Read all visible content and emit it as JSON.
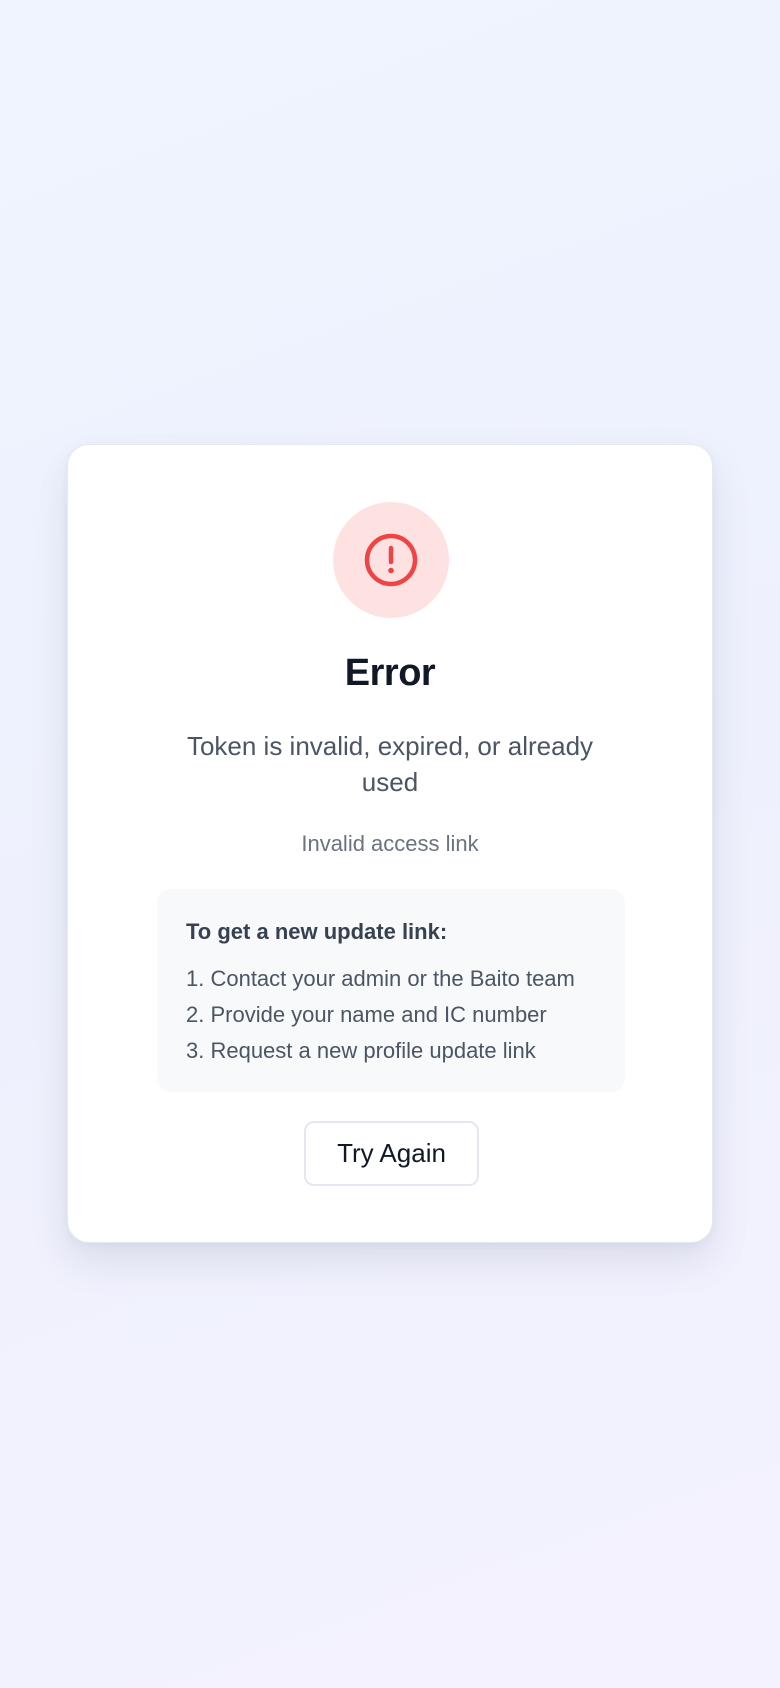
{
  "error": {
    "icon": "alert-circle-icon",
    "title": "Error",
    "message": "Token is invalid, expired, or already used",
    "subtext": "Invalid access link"
  },
  "instructions": {
    "heading": "To get a new update link:",
    "steps": [
      "1. Contact your admin or the Baito team",
      "2. Provide your name and IC number",
      "3. Request a new profile update link"
    ]
  },
  "actions": {
    "retry_label": "Try Again"
  },
  "colors": {
    "error_red": "#ef4444",
    "error_bg": "#fee2e2",
    "title": "#111827",
    "body_text": "#4b5563",
    "muted_text": "#6b7280"
  }
}
